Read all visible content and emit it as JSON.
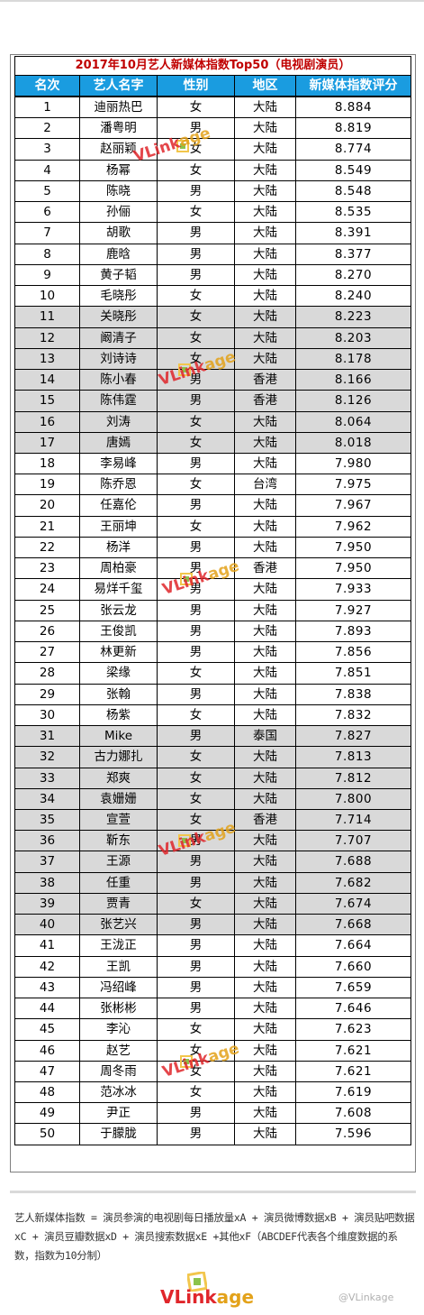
{
  "title": "2017年10月艺人新媒体指数Top50（电视剧演员）",
  "headers": [
    "名次",
    "艺人名字",
    "性别",
    "地区",
    "新媒体指数评分"
  ],
  "rows": [
    {
      "rank": "1",
      "name": "迪丽热巴",
      "gender": "女",
      "region": "大陆",
      "score": "8.884"
    },
    {
      "rank": "2",
      "name": "潘粤明",
      "gender": "男",
      "region": "大陆",
      "score": "8.819"
    },
    {
      "rank": "3",
      "name": "赵丽颖",
      "gender": "女",
      "region": "大陆",
      "score": "8.774"
    },
    {
      "rank": "4",
      "name": "杨幂",
      "gender": "女",
      "region": "大陆",
      "score": "8.549"
    },
    {
      "rank": "5",
      "name": "陈晓",
      "gender": "男",
      "region": "大陆",
      "score": "8.548"
    },
    {
      "rank": "6",
      "name": "孙俪",
      "gender": "女",
      "region": "大陆",
      "score": "8.535"
    },
    {
      "rank": "7",
      "name": "胡歌",
      "gender": "男",
      "region": "大陆",
      "score": "8.391"
    },
    {
      "rank": "8",
      "name": "鹿晗",
      "gender": "男",
      "region": "大陆",
      "score": "8.377"
    },
    {
      "rank": "9",
      "name": "黄子韬",
      "gender": "男",
      "region": "大陆",
      "score": "8.270"
    },
    {
      "rank": "10",
      "name": "毛晓彤",
      "gender": "女",
      "region": "大陆",
      "score": "8.240"
    },
    {
      "rank": "11",
      "name": "关晓彤",
      "gender": "女",
      "region": "大陆",
      "score": "8.223"
    },
    {
      "rank": "12",
      "name": "阚清子",
      "gender": "女",
      "region": "大陆",
      "score": "8.203"
    },
    {
      "rank": "13",
      "name": "刘诗诗",
      "gender": "女",
      "region": "大陆",
      "score": "8.178"
    },
    {
      "rank": "14",
      "name": "陈小春",
      "gender": "男",
      "region": "香港",
      "score": "8.166"
    },
    {
      "rank": "15",
      "name": "陈伟霆",
      "gender": "男",
      "region": "香港",
      "score": "8.126"
    },
    {
      "rank": "16",
      "name": "刘涛",
      "gender": "女",
      "region": "大陆",
      "score": "8.064"
    },
    {
      "rank": "17",
      "name": "唐嫣",
      "gender": "女",
      "region": "大陆",
      "score": "8.018"
    },
    {
      "rank": "18",
      "name": "李易峰",
      "gender": "男",
      "region": "大陆",
      "score": "7.980"
    },
    {
      "rank": "19",
      "name": "陈乔恩",
      "gender": "女",
      "region": "台湾",
      "score": "7.975"
    },
    {
      "rank": "20",
      "name": "任嘉伦",
      "gender": "男",
      "region": "大陆",
      "score": "7.967"
    },
    {
      "rank": "21",
      "name": "王丽坤",
      "gender": "女",
      "region": "大陆",
      "score": "7.962"
    },
    {
      "rank": "22",
      "name": "杨洋",
      "gender": "男",
      "region": "大陆",
      "score": "7.950"
    },
    {
      "rank": "23",
      "name": "周柏豪",
      "gender": "男",
      "region": "香港",
      "score": "7.950"
    },
    {
      "rank": "24",
      "name": "易烊千玺",
      "gender": "男",
      "region": "大陆",
      "score": "7.933"
    },
    {
      "rank": "25",
      "name": "张云龙",
      "gender": "男",
      "region": "大陆",
      "score": "7.927"
    },
    {
      "rank": "26",
      "name": "王俊凯",
      "gender": "男",
      "region": "大陆",
      "score": "7.893"
    },
    {
      "rank": "27",
      "name": "林更新",
      "gender": "男",
      "region": "大陆",
      "score": "7.856"
    },
    {
      "rank": "28",
      "name": "梁缘",
      "gender": "女",
      "region": "大陆",
      "score": "7.851"
    },
    {
      "rank": "29",
      "name": "张翰",
      "gender": "男",
      "region": "大陆",
      "score": "7.838"
    },
    {
      "rank": "30",
      "name": "杨紫",
      "gender": "女",
      "region": "大陆",
      "score": "7.832"
    },
    {
      "rank": "31",
      "name": "Mike",
      "gender": "男",
      "region": "泰国",
      "score": "7.827"
    },
    {
      "rank": "32",
      "name": "古力娜扎",
      "gender": "女",
      "region": "大陆",
      "score": "7.813"
    },
    {
      "rank": "33",
      "name": "郑爽",
      "gender": "女",
      "region": "大陆",
      "score": "7.812"
    },
    {
      "rank": "34",
      "name": "袁姗姗",
      "gender": "女",
      "region": "大陆",
      "score": "7.800"
    },
    {
      "rank": "35",
      "name": "宣萱",
      "gender": "女",
      "region": "香港",
      "score": "7.714"
    },
    {
      "rank": "36",
      "name": "靳东",
      "gender": "男",
      "region": "大陆",
      "score": "7.707"
    },
    {
      "rank": "37",
      "name": "王源",
      "gender": "男",
      "region": "大陆",
      "score": "7.688"
    },
    {
      "rank": "38",
      "name": "任重",
      "gender": "男",
      "region": "大陆",
      "score": "7.682"
    },
    {
      "rank": "39",
      "name": "贾青",
      "gender": "女",
      "region": "大陆",
      "score": "7.674"
    },
    {
      "rank": "40",
      "name": "张艺兴",
      "gender": "男",
      "region": "大陆",
      "score": "7.668"
    },
    {
      "rank": "41",
      "name": "王泷正",
      "gender": "男",
      "region": "大陆",
      "score": "7.664"
    },
    {
      "rank": "42",
      "name": "王凯",
      "gender": "男",
      "region": "大陆",
      "score": "7.660"
    },
    {
      "rank": "43",
      "name": "冯绍峰",
      "gender": "男",
      "region": "大陆",
      "score": "7.659"
    },
    {
      "rank": "44",
      "name": "张彬彬",
      "gender": "男",
      "region": "大陆",
      "score": "7.646"
    },
    {
      "rank": "45",
      "name": "李沁",
      "gender": "女",
      "region": "大陆",
      "score": "7.623"
    },
    {
      "rank": "46",
      "name": "赵艺",
      "gender": "女",
      "region": "大陆",
      "score": "7.621"
    },
    {
      "rank": "47",
      "name": "周冬雨",
      "gender": "女",
      "region": "大陆",
      "score": "7.621"
    },
    {
      "rank": "48",
      "name": "范冰冰",
      "gender": "女",
      "region": "大陆",
      "score": "7.619"
    },
    {
      "rank": "49",
      "name": "尹正",
      "gender": "男",
      "region": "大陆",
      "score": "7.608"
    },
    {
      "rank": "50",
      "name": "于朦胧",
      "gender": "男",
      "region": "大陆",
      "score": "7.596"
    }
  ],
  "watermark": {
    "v": "V",
    "link": "Link",
    "age": "age"
  },
  "note": "艺人新媒体指数 = 演员参演的电视剧每日播放量xA + 演员微博数据xB + 演员贴吧数据xC + 演员豆瓣数据xD + 演员搜索数据xE +其他xF（ABCDEF代表各个维度数据的系数，指数为10分制）",
  "logo": {
    "v": "V",
    "link": "Link",
    "age": "age"
  },
  "weibo_mark": "@VLinkage",
  "colors": {
    "header_bg": "#1a9ce0",
    "title_text": "#c00000",
    "shaded_row": "#d9d9d9",
    "brand_red": "#e0262b",
    "brand_orange": "#e3a21a"
  }
}
